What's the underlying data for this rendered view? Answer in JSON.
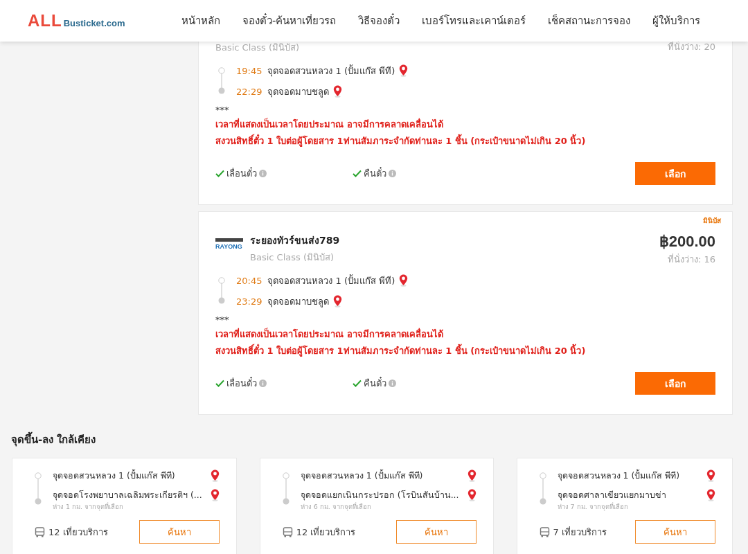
{
  "header": {
    "logo": {
      "brand": "ALL",
      "domain": "Busticket.com"
    },
    "nav": [
      {
        "label": "หน้าหลัก"
      },
      {
        "label": "จองตั๋ว-ค้นหาเที่ยวรถ"
      },
      {
        "label": "วิธีจองตั๋ว"
      },
      {
        "label": "เบอร์โทรและเคาน์เตอร์"
      },
      {
        "label": "เช็คสถานะการจอง"
      },
      {
        "label": "ผู้ให้บริการ"
      }
    ]
  },
  "trips": [
    {
      "class": "Basic Class (มินิบัส)",
      "seats": "ที่นั่งว่าง: 20",
      "stops": [
        {
          "time": "19:45",
          "place": "จุดจอดสวนหลวง 1 (ปั้มแก๊ส พีที)"
        },
        {
          "time": "22:29",
          "place": "จุดจอดมาบชลูด"
        }
      ],
      "note_mark": "***",
      "notes": [
        "เวลาที่แสดงเป็นเวลาโดยประมาณ อาจมีการคลาดเคลื่อนได้",
        "สงวนสิทธิ์ตั๋ว 1 ใบต่อผู้โดยสาร 1ท่านสัมภาระจำกัดท่านละ 1 ชิ้น (กระเป๋าขนาดไม่เกิน 20 นิ้ว)"
      ],
      "features": [
        {
          "label": "เลื่อนตั๋ว",
          "checked": true
        },
        {
          "label": "คืนตั๋ว",
          "checked": true
        }
      ],
      "button": "เลือก"
    },
    {
      "badge": "มินิบัส",
      "logo_text": "RAYONG",
      "operator": "ระยองทัวร์ขนส่ง789",
      "class": "Basic Class (มินิบัส)",
      "price": "฿200.00",
      "seats": "ที่นั่งว่าง: 16",
      "stops": [
        {
          "time": "20:45",
          "place": "จุดจอดสวนหลวง 1 (ปั้มแก๊ส พีที)"
        },
        {
          "time": "23:29",
          "place": "จุดจอดมาบชลูด"
        }
      ],
      "note_mark": "***",
      "notes": [
        "เวลาที่แสดงเป็นเวลาโดยประมาณ อาจมีการคลาดเคลื่อนได้",
        "สงวนสิทธิ์ตั๋ว 1 ใบต่อผู้โดยสาร 1ท่านสัมภาระจำกัดท่านละ 1 ชิ้น (กระเป๋าขนาดไม่เกิน 20 นิ้ว)"
      ],
      "features": [
        {
          "label": "เลื่อนตั๋ว",
          "checked": true
        },
        {
          "label": "คืนตั๋ว",
          "checked": true
        }
      ],
      "button": "เลือก"
    }
  ],
  "nearby": {
    "title": "จุดขึ้น-ลง ใกล้เคียง",
    "cards": [
      {
        "from": "จุดจอดสวนหลวง 1 (ปั้มแก๊ส พีที)",
        "to": "จุดจอดโรงพยาบาลเฉลิมพระเกียรติฯ (...",
        "distance": "ห่าง 1 กม. จากจุดที่เลือก",
        "trips": "12 เที่ยวบริการ",
        "button": "ค้นหา"
      },
      {
        "from": "จุดจอดสวนหลวง 1 (ปั้มแก๊ส พีที)",
        "to": "จุดจอดแยกเนินกระปรอก (โรบินสันบ้าน...",
        "distance": "ห่าง 6 กม. จากจุดที่เลือก",
        "trips": "12 เที่ยวบริการ",
        "button": "ค้นหา"
      },
      {
        "from": "จุดจอดสวนหลวง 1 (ปั้มแก๊ส พีที)",
        "to": "จุดจอดศาลาเขียวแยกมาบข่า",
        "distance": "ห่าง 7 กม. จากจุดที่เลือก",
        "trips": "7 เที่ยวบริการ",
        "button": "ค้นหา"
      }
    ]
  }
}
